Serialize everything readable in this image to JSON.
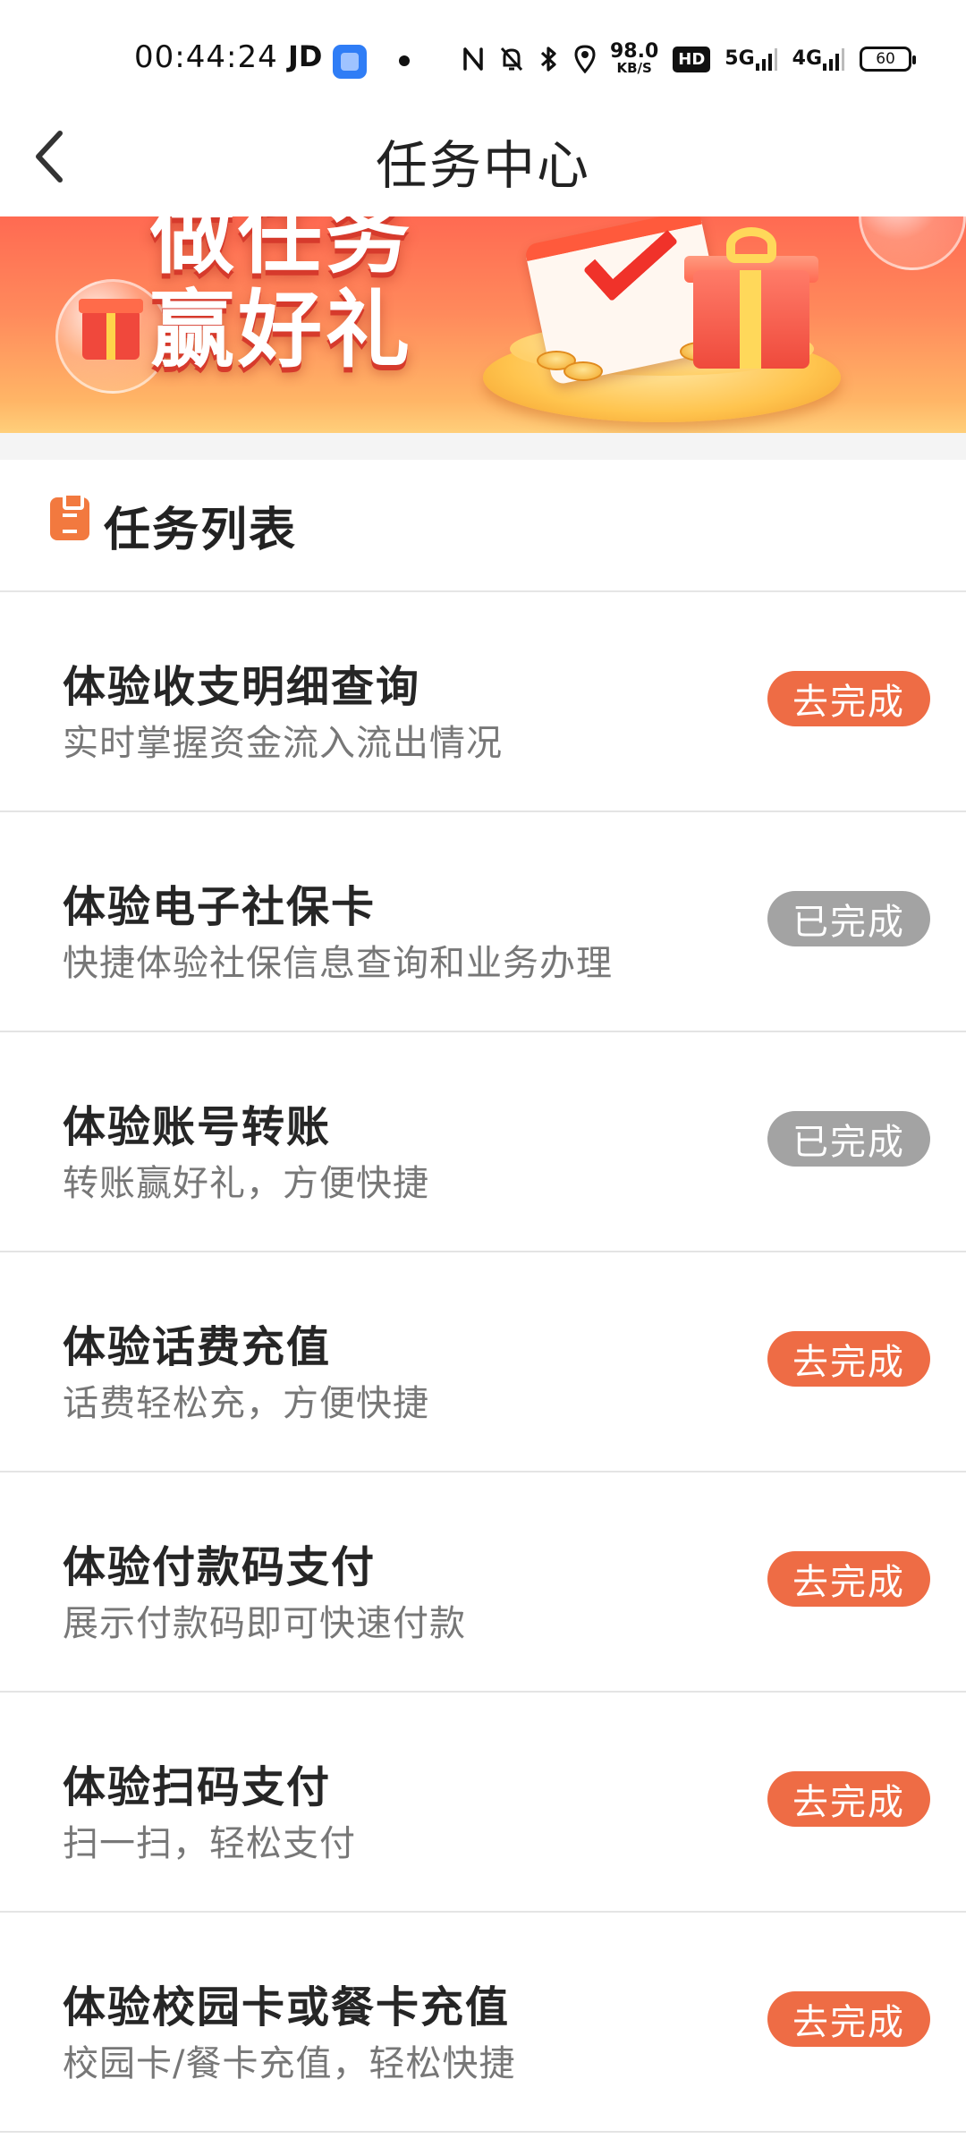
{
  "status_bar": {
    "time": "00:44:24",
    "carrier_label": "JD",
    "net_speed_value": "98.0",
    "net_speed_unit": "KB/S",
    "hd_label": "HD",
    "signal1_label": "5G",
    "signal2_label": "4G",
    "battery": "60",
    "icons": [
      "app-notification-icon",
      "nfc-icon",
      "mute-icon",
      "bluetooth-icon",
      "location-icon",
      "hd-icon",
      "signal-5g-icon",
      "signal-4g-icon",
      "battery-icon"
    ]
  },
  "nav": {
    "title": "任务中心",
    "back_icon": "chevron-left-icon"
  },
  "banner": {
    "line1": "做任务",
    "line2": "赢好礼"
  },
  "list_header": {
    "title": "任务列表",
    "icon": "clipboard-icon"
  },
  "colors": {
    "accent": "#ee6c45",
    "done": "#a3a3a3"
  },
  "tasks": [
    {
      "title": "体验收支明细查询",
      "desc": "实时掌握资金流入流出情况",
      "button": "去完成",
      "status": "pending"
    },
    {
      "title": "体验电子社保卡",
      "desc": "快捷体验社保信息查询和业务办理",
      "button": "已完成",
      "status": "done"
    },
    {
      "title": "体验账号转账",
      "desc": "转账赢好礼，方便快捷",
      "button": "已完成",
      "status": "done"
    },
    {
      "title": "体验话费充值",
      "desc": "话费轻松充，方便快捷",
      "button": "去完成",
      "status": "pending"
    },
    {
      "title": "体验付款码支付",
      "desc": "展示付款码即可快速付款",
      "button": "去完成",
      "status": "pending"
    },
    {
      "title": "体验扫码支付",
      "desc": "扫一扫，轻松支付",
      "button": "去完成",
      "status": "pending"
    },
    {
      "title": "体验校园卡或餐卡充值",
      "desc": "校园卡/餐卡充值，轻松快捷",
      "button": "去完成",
      "status": "pending"
    }
  ]
}
